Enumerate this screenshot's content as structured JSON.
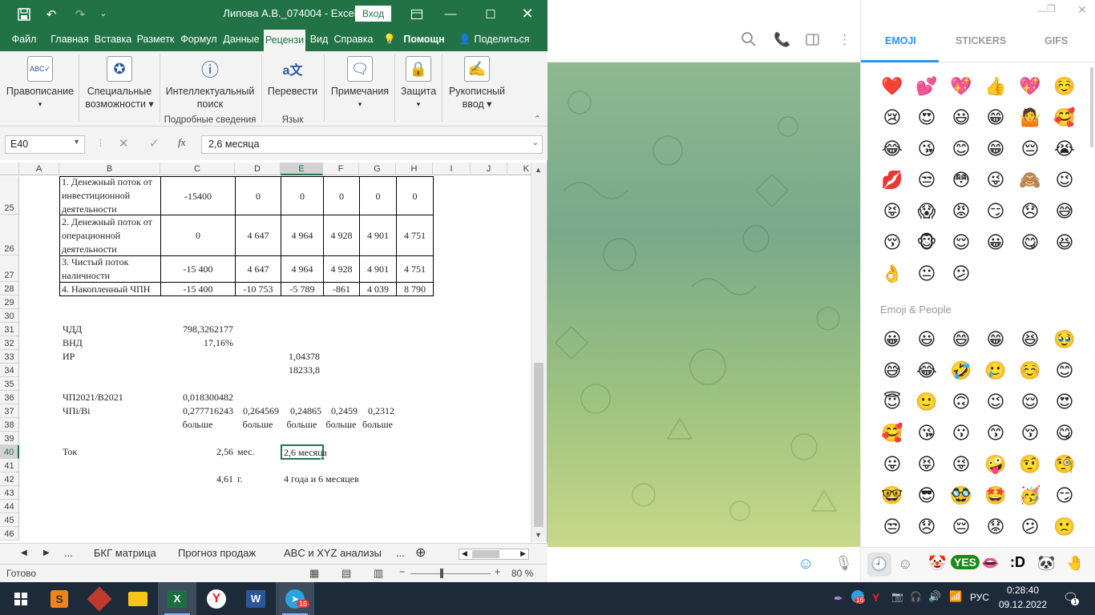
{
  "excel": {
    "title": "Липова А.В._074004  -  Excel",
    "signin": "Вход",
    "menu": [
      "Файл",
      "Главная",
      "Вставка",
      "Разметк",
      "Формул",
      "Данные",
      "Рецензи",
      "Вид",
      "Справка",
      "Помощн",
      "Поделиться"
    ],
    "ribbon": {
      "spelling": "Правописание",
      "accessibility1": "Специальные",
      "accessibility2": "возможности",
      "smart1": "Интеллектуальный",
      "smart2": "поиск",
      "insights_group": "Подробные сведения",
      "translate": "Перевести",
      "language_group": "Язык",
      "notes": "Примечания",
      "protect": "Защита",
      "ink1": "Рукописный",
      "ink2": "ввод"
    },
    "namebox": "E40",
    "formula": "2,6 месяца",
    "columns": [
      "A",
      "B",
      "C",
      "D",
      "E",
      "F",
      "G",
      "H",
      "I",
      "J",
      "K"
    ],
    "rows": [
      "25",
      "26",
      "27",
      "28",
      "29",
      "30",
      "31",
      "32",
      "33",
      "34",
      "35",
      "36",
      "37",
      "38",
      "39",
      "40",
      "41",
      "42",
      "43",
      "44",
      "45",
      "46"
    ],
    "cells": {
      "b25": "1. Денежный поток от инвестиционной деятельности",
      "c25": "-15400",
      "d25": "0",
      "e25": "0",
      "f25": "0",
      "g25": "0",
      "h25": "0",
      "b26": "2. Денежный поток от операционной деятельности",
      "c26": "0",
      "d26": "4 647",
      "e26": "4 964",
      "f26": "4 928",
      "g26": "4 901",
      "h26": "4 751",
      "b27": "3. Чистый поток наличности",
      "c27": "-15 400",
      "d27": "4 647",
      "e27": "4 964",
      "f27": "4 928",
      "g27": "4 901",
      "h27": "4 751",
      "b28": "4. Накопленный ЧПН",
      "c28": "-15 400",
      "d28": "-10 753",
      "e28": "-5 789",
      "f28": "-861",
      "g28": "4 039",
      "h28": "8 790",
      "b31": "ЧДД",
      "c31": "798,3262177",
      "b32": "ВНД",
      "c32": "17,16%",
      "b33": "ИР",
      "e33": "1,04378",
      "e34": "18233,8",
      "b36": "ЧП2021/В2021",
      "c36": "0,018300482",
      "b37": "ЧПi/Вi",
      "c37": "0,277716243",
      "d37": "0,264569",
      "e37": "0,24865",
      "f37": "0,2459",
      "g37": "0,2312",
      "c38": "больше",
      "d38": "больше",
      "e38": "больше",
      "f38": "больше",
      "g38": "больше",
      "b40": "Ток",
      "c40": "2,56",
      "d40": "мес.",
      "e40": "2,6 месяца",
      "c42": "4,61",
      "d42": "г.",
      "e42": "4 года и 6 месяцев"
    },
    "sheets": [
      "...",
      "БКГ матрица",
      "Прогноз продаж",
      "ABC и XYZ анализы",
      "..."
    ],
    "status": "Готово",
    "zoom": "80 %"
  },
  "emoji": {
    "tabs": [
      "EMOJI",
      "STICKERS",
      "GIFS"
    ],
    "recent": [
      "❤️",
      "💕",
      "💖",
      "👍",
      "💖",
      "☺️",
      "😢",
      "😍",
      "😃",
      "😁",
      "🤷",
      "🥰",
      "😂",
      "😘",
      "😊",
      "😁",
      "😔",
      "😭",
      "💋",
      "😒",
      "😳",
      "😜",
      "🙈",
      "😉",
      "😝",
      "😱",
      "😡",
      "😏",
      "😞",
      "😅",
      "😚",
      "🐵",
      "😌",
      "😀",
      "😋",
      "😆",
      "👌",
      "😐",
      "😕"
    ],
    "section": "Emoji & People",
    "people": [
      "😀",
      "😃",
      "😄",
      "😁",
      "😆",
      "🥹",
      "😅",
      "😂",
      "🤣",
      "🥲",
      "☺️",
      "😊",
      "😇",
      "🙂",
      "🙃",
      "😉",
      "😌",
      "😍",
      "🥰",
      "😘",
      "😗",
      "😙",
      "😚",
      "😋",
      "😛",
      "😝",
      "😜",
      "🤪",
      "🤨",
      "🧐",
      "🤓",
      "😎",
      "🥸",
      "🤩",
      "🥳",
      "😏",
      "😒",
      "😞",
      "😔",
      "😟",
      "😕",
      "🙁"
    ]
  },
  "taskbar": {
    "lang": "РУС",
    "time": "0:28:40",
    "date": "09.12.2022",
    "badge_tg": "16",
    "badge_notif": "1"
  },
  "colors": {
    "excel_green": "#217346",
    "taskbar": "#1c2a3a",
    "telegram_accent": "#3390ec"
  }
}
